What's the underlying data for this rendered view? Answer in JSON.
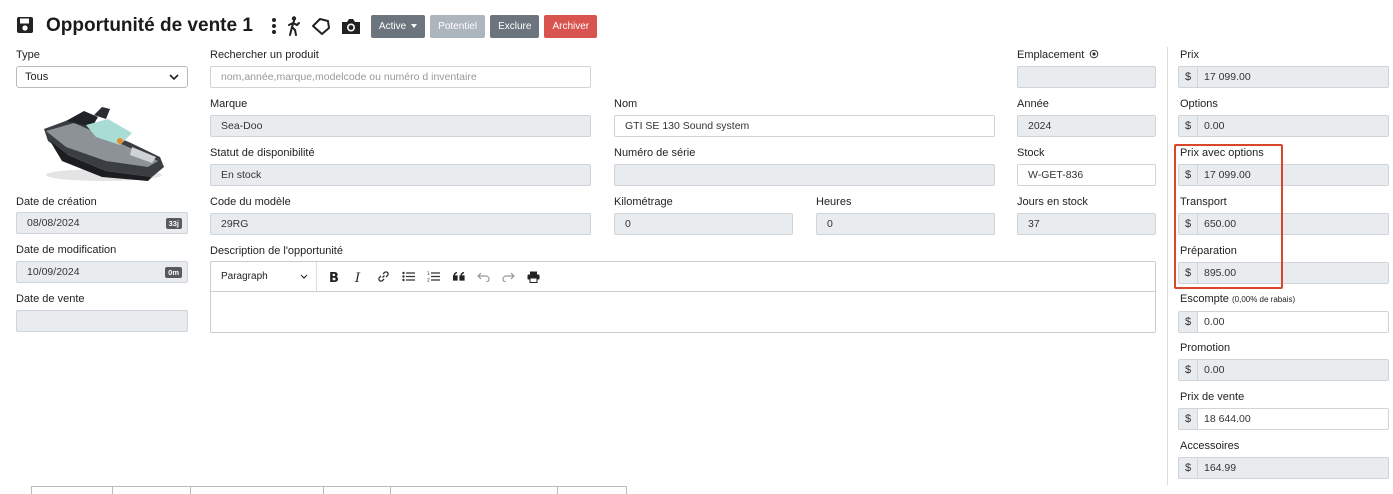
{
  "header": {
    "title": "Opportunité de vente 1",
    "buttons": {
      "active": "Active",
      "potentiel": "Potentiel",
      "exclure": "Exclure",
      "archiver": "Archiver"
    },
    "icons": [
      "save-icon",
      "more-vertical-icon",
      "walking-icon",
      "tag-icon",
      "camera-icon"
    ]
  },
  "left": {
    "type_label": "Type",
    "type_value": "Tous",
    "creation_label": "Date de création",
    "creation_value": "08/08/2024",
    "creation_badge": "33j",
    "modification_label": "Date de modification",
    "modification_value": "10/09/2024",
    "modification_badge": "0m",
    "vente_label": "Date de vente",
    "vente_value": ""
  },
  "main": {
    "search_label": "Rechercher un produit",
    "search_placeholder": "nom,année,marque,modelcode ou numéro d inventaire",
    "marque_label": "Marque",
    "marque_value": "Sea-Doo",
    "nom_label": "Nom",
    "nom_value": "GTI SE 130 Sound system",
    "statut_label": "Statut de disponibilité",
    "statut_value": "En stock",
    "serie_label": "Numéro de série",
    "serie_value": "",
    "code_label": "Code du modèle",
    "code_value": "29RG",
    "km_label": "Kilométrage",
    "km_value": "0",
    "heures_label": "Heures",
    "heures_value": "0",
    "description_label": "Description de l'opportunité",
    "editor_format": "Paragraph"
  },
  "col3": {
    "emplacement_label": "Emplacement",
    "emplacement_value": "",
    "annee_label": "Année",
    "annee_value": "2024",
    "stock_label": "Stock",
    "stock_value": "W-GET-836",
    "jours_label": "Jours en stock",
    "jours_value": "37"
  },
  "pricing": {
    "currency": "$",
    "prix_label": "Prix",
    "prix_value": "17 099.00",
    "options_label": "Options",
    "options_value": "0.00",
    "prix_options_label": "Prix avec options",
    "prix_options_value": "17 099.00",
    "transport_label": "Transport",
    "transport_value": "650.00",
    "preparation_label": "Préparation",
    "preparation_value": "895.00",
    "escompte_label": "Escompte",
    "escompte_note": "(0,00% de rabais)",
    "escompte_value": "0.00",
    "promotion_label": "Promotion",
    "promotion_value": "0.00",
    "prix_vente_label": "Prix de vente",
    "prix_vente_value": "18 644.00",
    "accessoires_label": "Accessoires",
    "accessoires_value": "164.99"
  },
  "colors": {
    "highlight": "#d9472b",
    "archiver": "#d9534f",
    "readonly_bg": "#e9ecef"
  }
}
